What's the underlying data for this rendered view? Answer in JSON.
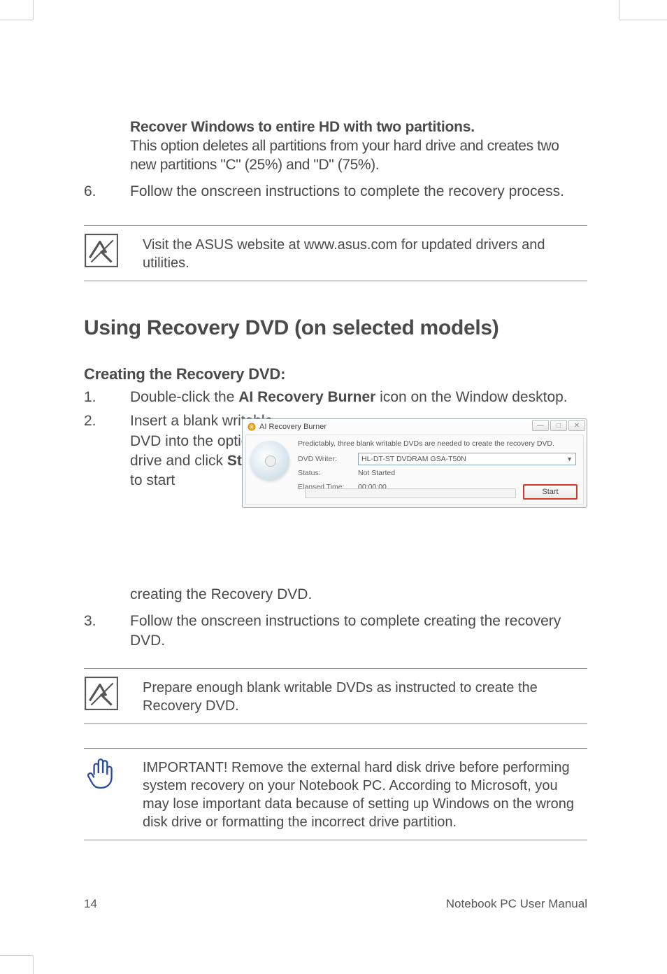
{
  "option": {
    "title": "Recover Windows to entire HD with two partitions.",
    "desc": "This option deletes all partitions from your hard drive and creates two new partitions \"C\" (25%) and \"D\" (75%)."
  },
  "step6": {
    "num": "6.",
    "text": "Follow the onscreen instructions to complete the recovery process."
  },
  "note1": "Visit the ASUS website at www.asus.com for updated drivers and utilities.",
  "h1": "Using Recovery DVD (on selected models)",
  "h2": "Creating the Recovery DVD:",
  "creating": {
    "step1": {
      "num": "1.",
      "pre": "Double-click the ",
      "bold": "AI Recovery Burner",
      "post": " icon on the Window desktop."
    },
    "step2": {
      "num": "2.",
      "pre": "Insert a blank writable DVD into the optical drive and click ",
      "bold": "Start",
      "post": " to start creating the Recovery DVD."
    },
    "continuation": "creating the Recovery DVD.",
    "step3": {
      "num": "3.",
      "text": "Follow the onscreen instructions to complete creating the recovery DVD."
    }
  },
  "note2": "Prepare enough blank writable DVDs as instructed to create the Recovery DVD.",
  "important": "IMPORTANT! Remove the external hard disk drive before performing system recovery on your Notebook PC. According to Microsoft, you may lose important data because of setting up Windows on the wrong disk drive or formatting the incorrect drive partition.",
  "screenshot": {
    "title": "AI Recovery Burner",
    "message": "Predictably, three blank writable DVDs are needed to create the recovery DVD.",
    "dvd_writer_label": "DVD Writer:",
    "dvd_writer_value": "HL-DT-ST DVDRAM GSA-T50N",
    "status_label": "Status:",
    "status_value": "Not Started",
    "elapsed_label": "Elapsed Time:",
    "elapsed_value": "00:00:00",
    "start_btn": "Start"
  },
  "footer": {
    "page": "14",
    "title": "Notebook PC User Manual"
  }
}
